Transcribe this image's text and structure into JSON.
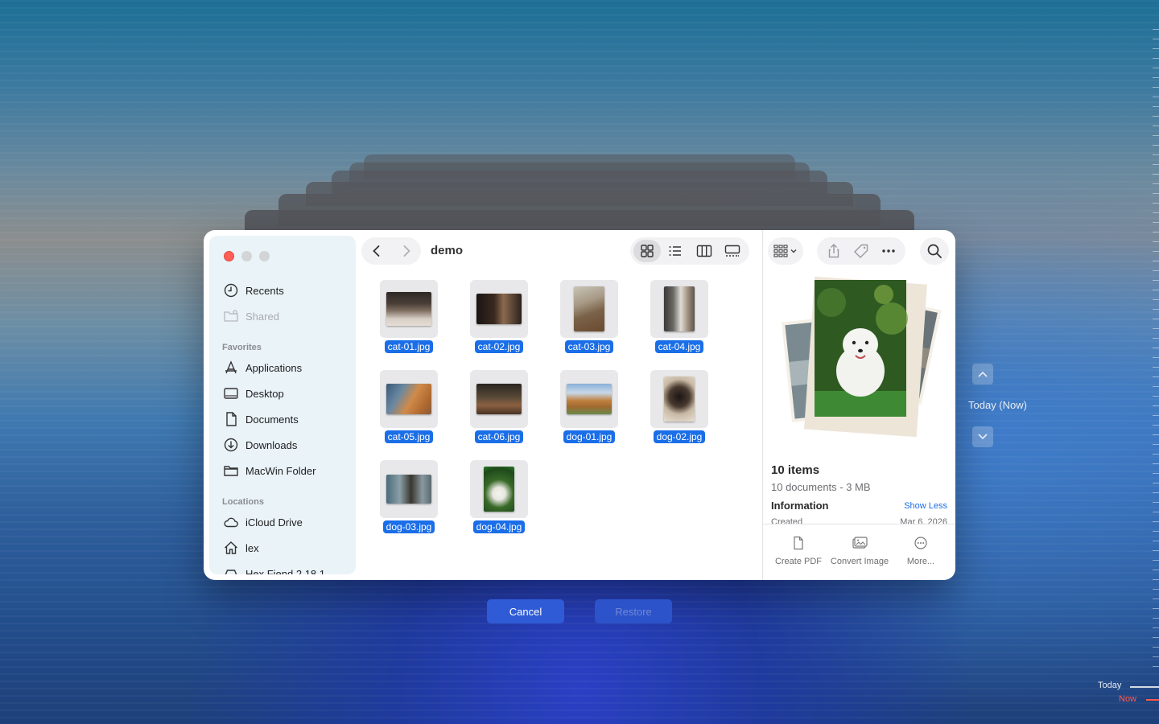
{
  "finder": {
    "folder_title": "demo",
    "sidebar": {
      "recents": "Recents",
      "shared": "Shared",
      "favorites_header": "Favorites",
      "favorites": [
        "Applications",
        "Desktop",
        "Documents",
        "Downloads",
        "MacWin Folder"
      ],
      "locations_header": "Locations",
      "locations": [
        "iCloud Drive",
        "lex",
        "Hex Fiend 2.18.1"
      ]
    },
    "files": [
      "cat-01.jpg",
      "cat-02.jpg",
      "cat-03.jpg",
      "cat-04.jpg",
      "cat-05.jpg",
      "cat-06.jpg",
      "dog-01.jpg",
      "dog-02.jpg",
      "dog-03.jpg",
      "dog-04.jpg"
    ],
    "preview": {
      "title": "10 items",
      "subtitle": "10 documents - 3 MB",
      "info_label": "Information",
      "toggle_label": "Show Less",
      "created_label": "Created",
      "created_value": "Mar 6, 2026"
    },
    "quick_actions": [
      "Create PDF",
      "Convert Image",
      "More..."
    ]
  },
  "dialog": {
    "cancel_label": "Cancel",
    "restore_label": "Restore"
  },
  "time_machine": {
    "current_label": "Today (Now)",
    "timeline_today": "Today",
    "timeline_now": "Now"
  },
  "colors": {
    "accent": "#1a6ee8",
    "close": "#ff5f57",
    "now_marker": "#ff5a4f"
  }
}
